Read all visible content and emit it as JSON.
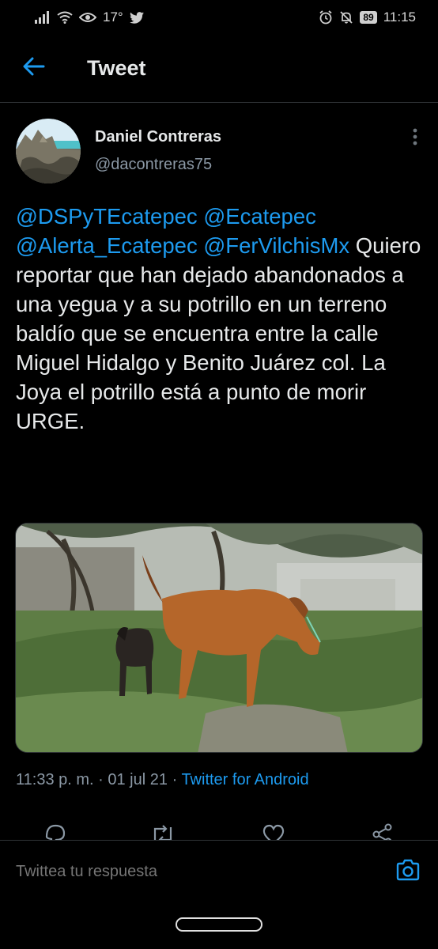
{
  "status_bar": {
    "signal_icon": "signal-icon",
    "wifi_icon": "wifi-icon",
    "eye_icon": "eye-icon",
    "temperature": "17°",
    "twitter_icon": "twitter-bird-icon",
    "alarm_icon": "alarm-icon",
    "mute_icon": "bell-off-icon",
    "battery": "89",
    "time": "11:15"
  },
  "header": {
    "back_icon": "arrow-left-icon",
    "title": "Tweet"
  },
  "tweet": {
    "author_name": "Daniel Contreras",
    "author_handle": "@dacontreras75",
    "more_icon": "more-vertical-icon",
    "mentions": [
      "@DSPyTEcatepec",
      "@Ecatepec",
      "@Alerta_Ecatepec",
      "@FerVilchisMx"
    ],
    "body": "Quiero reportar que han dejado abandonados  a una yegua y a su potrillo en un terreno baldío que se encuentra entre la calle Miguel Hidalgo y Benito Juárez col. La Joya el potrillo está a punto de morir URGE.",
    "time": "11:33 p. m.",
    "separator": "·",
    "date": "01 jul 21",
    "source": "Twitter for Android"
  },
  "actions": {
    "reply_icon": "reply-icon",
    "retweet_icon": "retweet-icon",
    "like_icon": "heart-icon",
    "share_icon": "share-icon"
  },
  "reply_bar": {
    "placeholder": "Twittea tu respuesta",
    "camera_icon": "camera-icon"
  },
  "colors": {
    "background": "#000000",
    "accent": "#1d9bf0",
    "text_primary": "#e7e9ea",
    "text_secondary": "#8b98a5",
    "divider": "#2f3336"
  }
}
